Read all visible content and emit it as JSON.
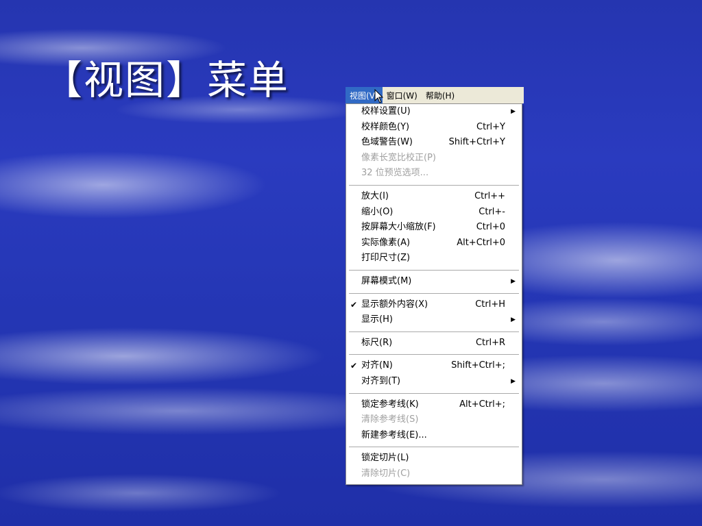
{
  "slide": {
    "title": "【视图】菜单"
  },
  "menubar": {
    "items": [
      {
        "label": "视图(V)",
        "active": true
      },
      {
        "label": "窗口(W)",
        "active": false
      },
      {
        "label": "帮助(H)",
        "active": false
      }
    ]
  },
  "dropdown": {
    "groups": [
      [
        {
          "label": "校样设置(U)",
          "shortcut": "",
          "submenu": true,
          "checked": false,
          "disabled": false
        },
        {
          "label": "校样颜色(Y)",
          "shortcut": "Ctrl+Y",
          "submenu": false,
          "checked": false,
          "disabled": false
        },
        {
          "label": "色域警告(W)",
          "shortcut": "Shift+Ctrl+Y",
          "submenu": false,
          "checked": false,
          "disabled": false
        },
        {
          "label": "像素长宽比校正(P)",
          "shortcut": "",
          "submenu": false,
          "checked": false,
          "disabled": true
        },
        {
          "label": "32 位预览选项...",
          "shortcut": "",
          "submenu": false,
          "checked": false,
          "disabled": true
        }
      ],
      [
        {
          "label": "放大(I)",
          "shortcut": "Ctrl++",
          "submenu": false,
          "checked": false,
          "disabled": false
        },
        {
          "label": "缩小(O)",
          "shortcut": "Ctrl+-",
          "submenu": false,
          "checked": false,
          "disabled": false
        },
        {
          "label": "按屏幕大小缩放(F)",
          "shortcut": "Ctrl+0",
          "submenu": false,
          "checked": false,
          "disabled": false
        },
        {
          "label": "实际像素(A)",
          "shortcut": "Alt+Ctrl+0",
          "submenu": false,
          "checked": false,
          "disabled": false
        },
        {
          "label": "打印尺寸(Z)",
          "shortcut": "",
          "submenu": false,
          "checked": false,
          "disabled": false
        }
      ],
      [
        {
          "label": "屏幕模式(M)",
          "shortcut": "",
          "submenu": true,
          "checked": false,
          "disabled": false
        }
      ],
      [
        {
          "label": "显示额外内容(X)",
          "shortcut": "Ctrl+H",
          "submenu": false,
          "checked": true,
          "disabled": false
        },
        {
          "label": "显示(H)",
          "shortcut": "",
          "submenu": true,
          "checked": false,
          "disabled": false
        }
      ],
      [
        {
          "label": "标尺(R)",
          "shortcut": "Ctrl+R",
          "submenu": false,
          "checked": false,
          "disabled": false
        }
      ],
      [
        {
          "label": "对齐(N)",
          "shortcut": "Shift+Ctrl+;",
          "submenu": false,
          "checked": true,
          "disabled": false
        },
        {
          "label": "对齐到(T)",
          "shortcut": "",
          "submenu": true,
          "checked": false,
          "disabled": false
        }
      ],
      [
        {
          "label": "锁定参考线(K)",
          "shortcut": "Alt+Ctrl+;",
          "submenu": false,
          "checked": false,
          "disabled": false
        },
        {
          "label": "清除参考线(S)",
          "shortcut": "",
          "submenu": false,
          "checked": false,
          "disabled": true
        },
        {
          "label": "新建参考线(E)...",
          "shortcut": "",
          "submenu": false,
          "checked": false,
          "disabled": false
        }
      ],
      [
        {
          "label": "锁定切片(L)",
          "shortcut": "",
          "submenu": false,
          "checked": false,
          "disabled": false
        },
        {
          "label": "清除切片(C)",
          "shortcut": "",
          "submenu": false,
          "checked": false,
          "disabled": true
        }
      ]
    ]
  },
  "colors": {
    "menubar_bg": "#ece9d8",
    "highlight": "#316ac5",
    "disabled_text": "#a0a0a0",
    "slide_title": "#ffffff"
  }
}
